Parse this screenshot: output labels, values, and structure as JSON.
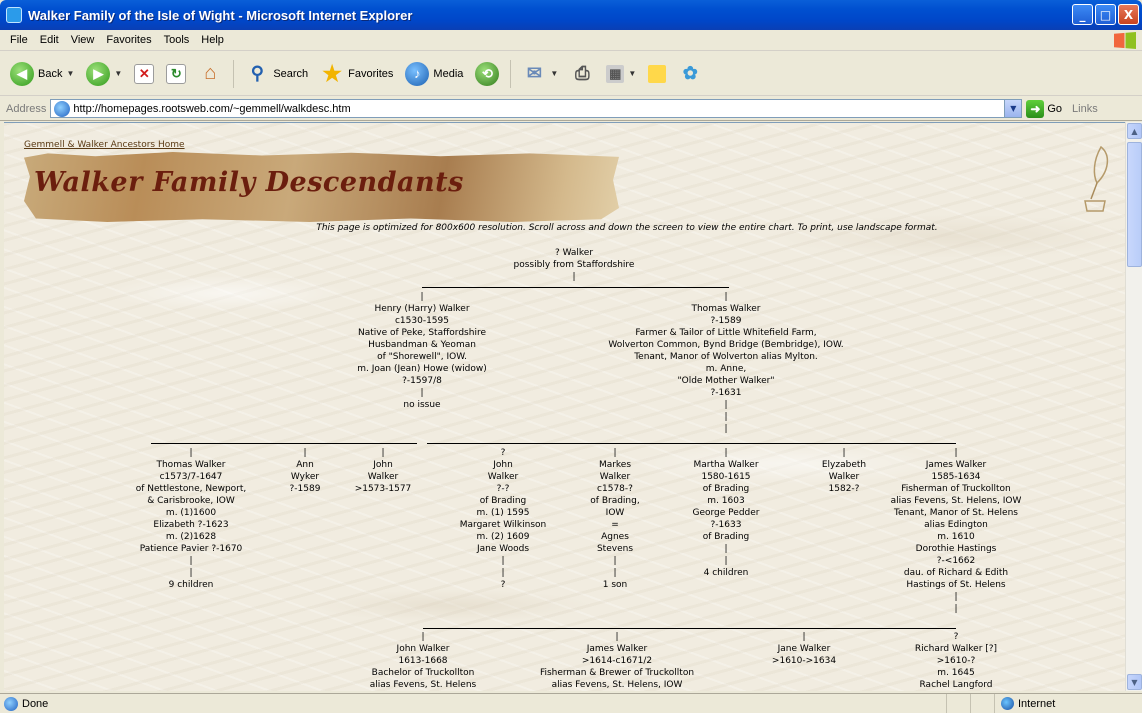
{
  "window": {
    "title": "Walker Family of the Isle of Wight - Microsoft Internet Explorer",
    "minimize": "_",
    "maximize": "□",
    "close": "X"
  },
  "menu": [
    "File",
    "Edit",
    "View",
    "Favorites",
    "Tools",
    "Help"
  ],
  "toolbar": {
    "back_label": "Back",
    "search_label": "Search",
    "favorites_label": "Favorites",
    "media_label": "Media"
  },
  "address": {
    "label": "Address",
    "url": "http://homepages.rootsweb.com/~gemmell/walkdesc.htm",
    "go_label": "Go",
    "links_label": "Links"
  },
  "page": {
    "home_link": "Gemmell & Walker Ancestors Home",
    "banner_title": "Walker Family Descendants",
    "notice": "This page is optimized for 800x600 resolution. Scroll across and down the screen to view the entire chart. To print, use landscape format."
  },
  "tree": {
    "root": [
      "? Walker",
      "possibly from Staffordshire",
      "|"
    ],
    "henry": [
      "|",
      "Henry (Harry) Walker",
      "c1530-1595",
      "Native of Peke, Staffordshire",
      "Husbandman & Yeoman",
      "of \"Shorewell\", IOW.",
      "m. Joan (Jean) Howe (widow)",
      "?-1597/8",
      "|",
      "no issue"
    ],
    "thomas_sr": [
      "|",
      "Thomas Walker",
      "?-1589",
      "Farmer & Tailor of Little Whitefield Farm,",
      "Wolverton Common, Bynd Bridge (Bembridge), IOW.",
      "Tenant, Manor of Wolverton alias Mylton.",
      "m. Anne,",
      "\"Olde Mother Walker\"",
      "?-1631",
      "|",
      "|",
      "|"
    ],
    "gen3": [
      [
        "|",
        "Thomas Walker",
        "c1573/7-1647",
        "of Nettlestone, Newport,",
        "& Carisbrooke, IOW",
        "m. (1)1600",
        "Elizabeth ?-1623",
        "m. (2)1628",
        "Patience Pavier ?-1670",
        "|",
        "|",
        "9 children"
      ],
      [
        "|",
        "Ann",
        "Wyker",
        "?-1589"
      ],
      [
        "|",
        "John",
        "Walker",
        ">1573-1577"
      ],
      [
        "?",
        "John",
        "Walker",
        "?-?",
        "of Brading",
        "m. (1) 1595",
        "Margaret Wilkinson",
        "m. (2) 1609",
        "Jane Woods",
        "|",
        "|",
        "?"
      ],
      [
        "|",
        "Markes",
        "Walker",
        "c1578-?",
        "of Brading,",
        "IOW",
        "=",
        "Agnes",
        "Stevens",
        "|",
        "|",
        "1 son"
      ],
      [
        "|",
        "Martha Walker",
        "1580-1615",
        "of Brading",
        "m. 1603",
        "George Pedder",
        "?-1633",
        "of Brading",
        "|",
        "|",
        "4 children"
      ],
      [
        "|",
        "Elyzabeth",
        "Walker",
        "1582-?"
      ],
      [
        "|",
        "James Walker",
        "1585-1634",
        "Fisherman of Truckollton",
        "alias Fevens, St. Helens, IOW",
        "Tenant, Manor of St. Helens",
        "alias Edington",
        "m. 1610",
        "Dorothie Hastings",
        "?-<1662",
        "dau. of Richard & Edith",
        "Hastings of St. Helens",
        "|",
        "|"
      ]
    ],
    "gen4": [
      [
        "|",
        "John Walker",
        "1613-1668",
        "Bachelor of Truckollton",
        "alias Fevens, St. Helens"
      ],
      [
        "|",
        "James Walker",
        ">1614-c1671/2",
        "Fisherman & Brewer of Truckollton",
        "alias Fevens, St. Helens, IOW"
      ],
      [
        "|",
        "Jane Walker",
        ">1610->1634"
      ],
      [
        "?",
        "Richard Walker [?]",
        ">1610-?",
        "m. 1645",
        "Rachel Langford"
      ]
    ]
  },
  "status": {
    "text": "Done",
    "zone": "Internet"
  }
}
